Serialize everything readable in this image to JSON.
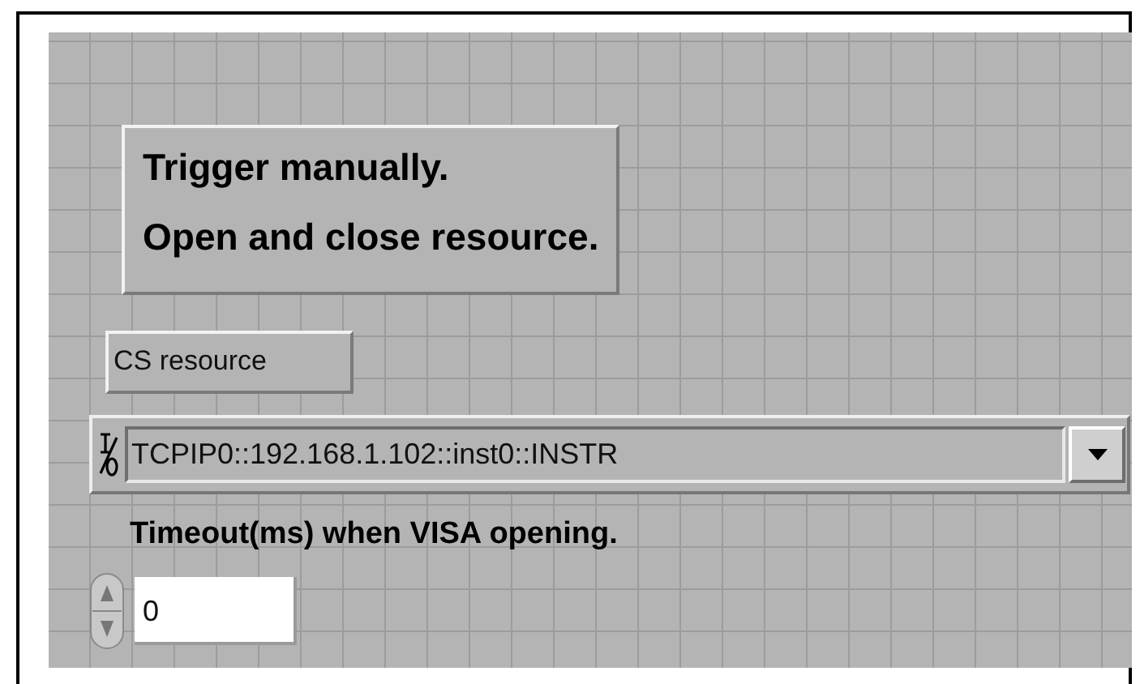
{
  "comment": {
    "lines": [
      "Trigger manually.",
      "Open and close resource."
    ]
  },
  "resource_label": "CS resource",
  "resource": {
    "value": "TCPIP0::192.168.1.102::inst0::INSTR"
  },
  "timeout": {
    "label": "Timeout(ms) when VISA opening.",
    "value": "0"
  }
}
